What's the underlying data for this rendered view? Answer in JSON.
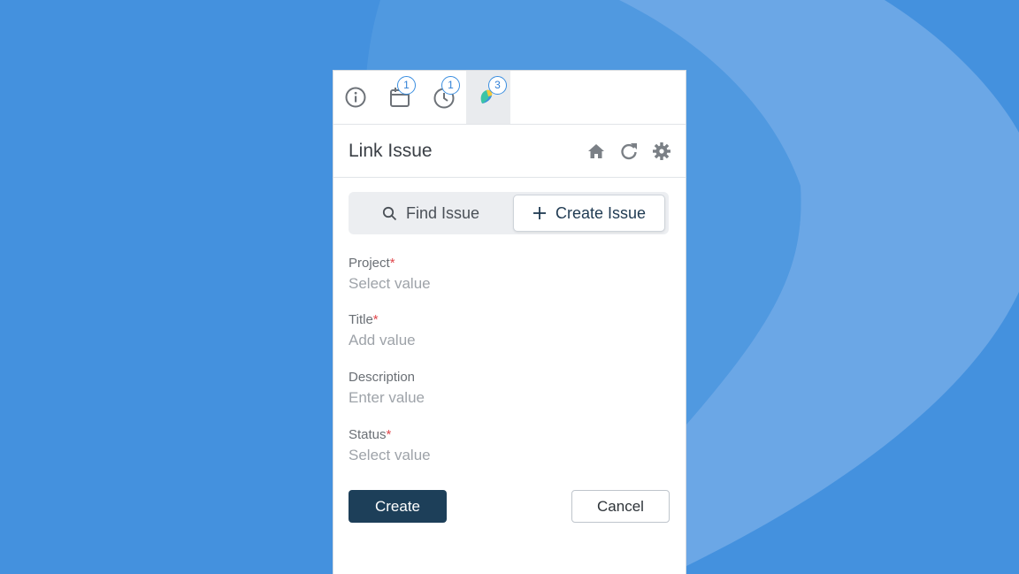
{
  "tabs": [
    {
      "icon": "info-icon",
      "badge": ""
    },
    {
      "icon": "calendar-icon",
      "badge": "1"
    },
    {
      "icon": "clock-icon",
      "badge": "1"
    },
    {
      "icon": "app-logo-icon",
      "badge": "3"
    }
  ],
  "header": {
    "title": "Link Issue",
    "icons": [
      "home-icon",
      "refresh-icon",
      "settings-icon"
    ]
  },
  "segment": {
    "find_label": "Find Issue",
    "create_label": "Create Issue"
  },
  "form": {
    "project": {
      "label": "Project",
      "required": "*",
      "value": "Select value"
    },
    "title": {
      "label": "Title",
      "required": "*",
      "value": "Add value"
    },
    "description": {
      "label": "Description",
      "value": "Enter value"
    },
    "status": {
      "label": "Status",
      "required": "*",
      "value": "Select value"
    }
  },
  "actions": {
    "create_label": "Create",
    "cancel_label": "Cancel"
  },
  "colors": {
    "background": "#4491de",
    "primary_button": "#1d3f59",
    "badge_border": "#3a8ee0",
    "required": "#e0474c"
  }
}
